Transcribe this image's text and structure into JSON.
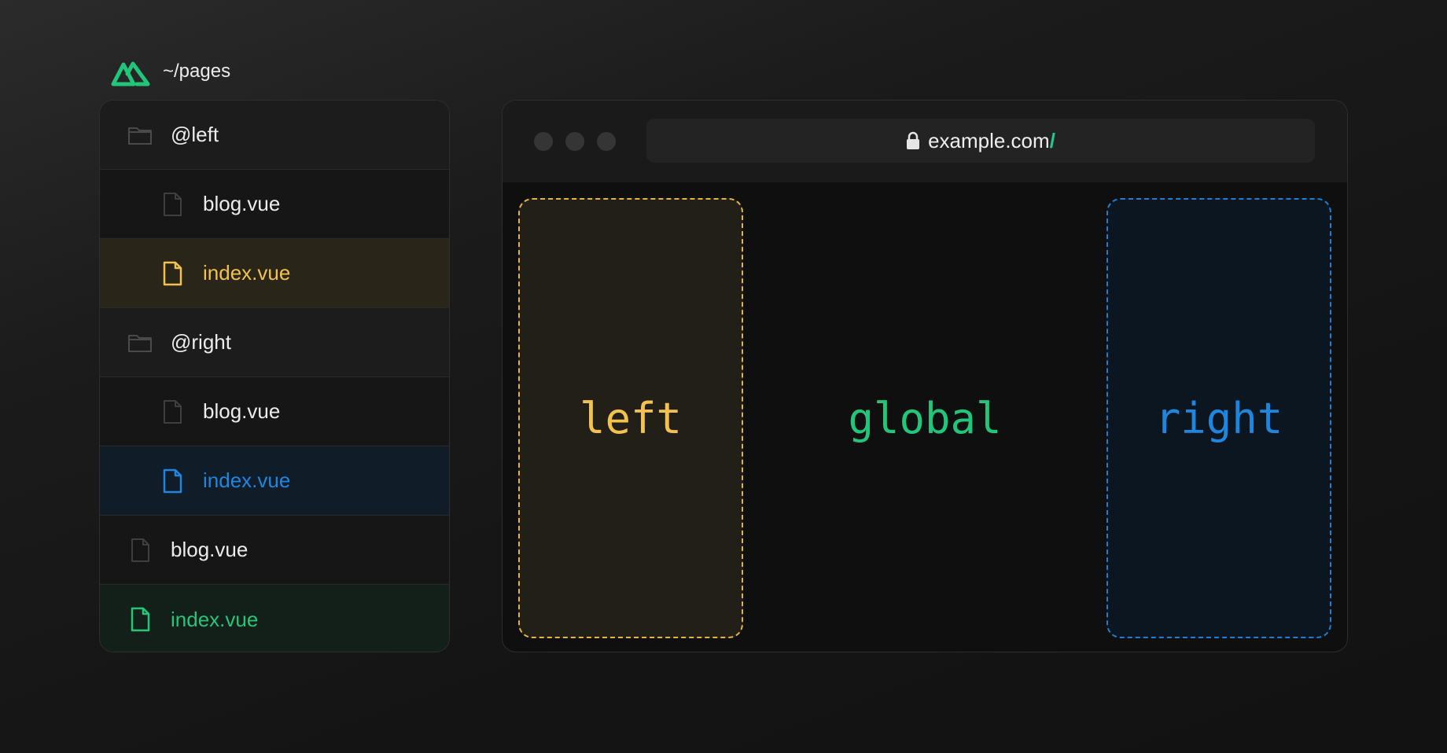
{
  "header": {
    "path": "~/pages",
    "logo": "nuxt-logo"
  },
  "tree": {
    "items": [
      {
        "label": "@left",
        "type": "folder",
        "icon": "folder-icon"
      },
      {
        "label": "blog.vue",
        "type": "file",
        "icon": "file-icon"
      },
      {
        "label": "index.vue",
        "type": "file",
        "icon": "file-icon",
        "color": "#f2c24d"
      },
      {
        "label": "@right",
        "type": "folder",
        "icon": "folder-icon"
      },
      {
        "label": "blog.vue",
        "type": "file",
        "icon": "file-icon"
      },
      {
        "label": "index.vue",
        "type": "file",
        "icon": "file-icon",
        "color": "#1d86de"
      },
      {
        "label": "blog.vue",
        "type": "file",
        "icon": "file-icon"
      },
      {
        "label": "index.vue",
        "type": "file",
        "icon": "file-icon",
        "color": "#20c77b"
      }
    ]
  },
  "browser": {
    "url": "example.com",
    "url_slash": "/",
    "panes": {
      "left": "left",
      "center": "global",
      "right": "right"
    }
  },
  "colors": {
    "yellow": "#f2c24d",
    "blue": "#1d86de",
    "green": "#20c77b"
  }
}
